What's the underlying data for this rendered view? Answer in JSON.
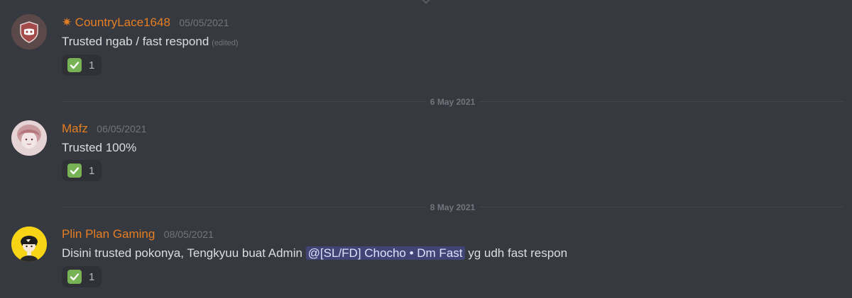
{
  "messages": [
    {
      "username": "CountryLace1648",
      "badge_icon": "✷",
      "timestamp": "05/05/2021",
      "text": "Trusted ngab / fast respond",
      "edited_label": "(edited)",
      "reaction": {
        "emoji": "white-check-mark",
        "count": "1"
      },
      "avatar": "discord-logo-shield"
    },
    {
      "username": "Mafz",
      "timestamp": "06/05/2021",
      "text": "Trusted 100%",
      "reaction": {
        "emoji": "white-check-mark",
        "count": "1"
      },
      "avatar": "anime-girl"
    },
    {
      "username": "Plin Plan Gaming",
      "timestamp": "08/05/2021",
      "text_before": "Disini trusted pokonya, Tengkyuu buat Admin ",
      "mention": "@[SL/FD] Chocho • Dm Fast",
      "text_after": " yg udh fast respon",
      "reaction": {
        "emoji": "white-check-mark",
        "count": "1"
      },
      "avatar": "anime-boy-yellow"
    }
  ],
  "dividers": [
    "6 May 2021",
    "8 May 2021"
  ],
  "colors": {
    "background": "#36393f",
    "username": "#e67e22",
    "timestamp": "#72767d",
    "text": "#dcddde",
    "mention_bg": "#414675",
    "reaction_bg": "#2f3136",
    "check_green": "#77b255"
  }
}
